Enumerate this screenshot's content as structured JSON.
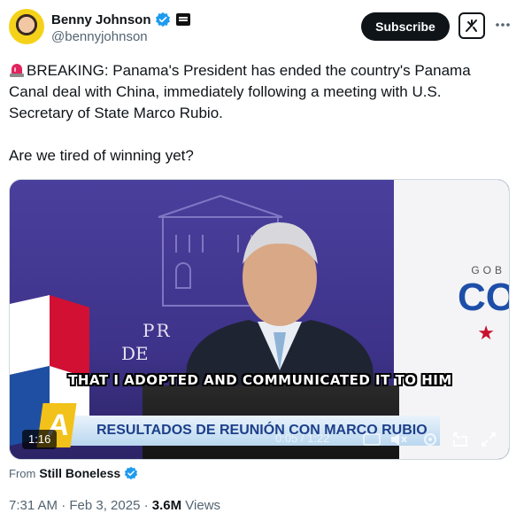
{
  "author": {
    "name": "Benny Johnson",
    "handle": "@bennyjohnson",
    "verified_icon": "verified-badge-icon",
    "affiliate_icon": "affiliate-badge-icon"
  },
  "actions": {
    "subscribe_label": "Subscribe",
    "grok_icon": "grok-icon",
    "more_icon": "more-icon"
  },
  "tweet": {
    "siren_icon": "siren-emoji",
    "line1": "BREAKING: Panama's President has ended the country's Panama Canal deal with China, immediately following a meeting with U.S. Secretary of State Marco Rubio.",
    "line2": "Are we tired of winning yet?"
  },
  "video": {
    "bg_text_pr": "PR",
    "bg_text_de": "DE",
    "bg_text_gob": "GOB",
    "bg_text_co": "CO",
    "caption": "THAT I ADOPTED AND COMMUNICATED IT TO HIM",
    "lower_third": "RESULTADOS DE REUNIÓN CON MARCO RUBIO",
    "logo_letter": "A",
    "duration_badge": "1:16",
    "progress_text": "0:05 / 1:22",
    "colors": {
      "purple": "#3f3690",
      "banner_text": "#1d3f8a",
      "logo_yellow": "#f2c21a"
    }
  },
  "source": {
    "from_label": "From",
    "source_name": "Still Boneless"
  },
  "meta": {
    "timestamp": "7:31 AM · Feb 3, 2025 · ",
    "views_count": "3.6M",
    "views_label": " Views"
  }
}
